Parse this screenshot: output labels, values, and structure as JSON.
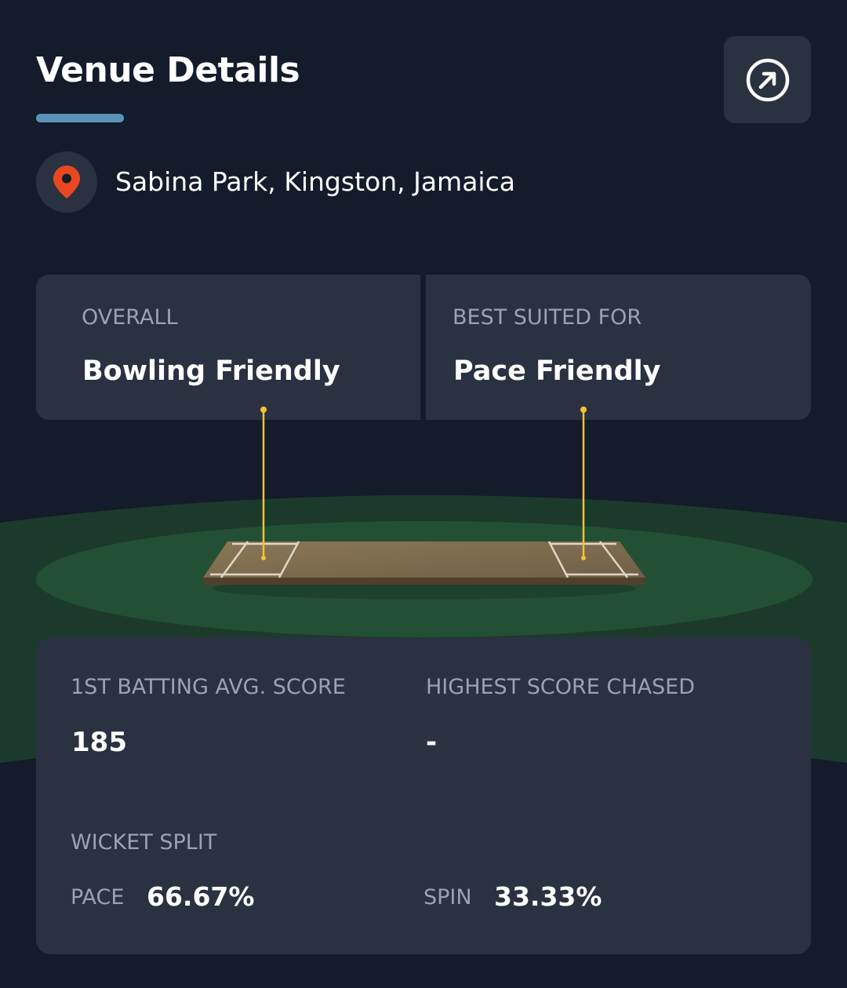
{
  "header": {
    "title": "Venue Details",
    "open_icon": "arrow-up-right-circle-icon"
  },
  "location": {
    "icon": "map-pin-icon",
    "pin_color": "#e8471f",
    "text": "Sabina Park, Kingston, Jamaica"
  },
  "summary": {
    "overall": {
      "label": "OVERALL",
      "value": "Bowling Friendly"
    },
    "best_suited": {
      "label": "BEST SUITED FOR",
      "value": "Pace Friendly"
    }
  },
  "stats": {
    "first_batting_avg": {
      "label": "1ST BATTING AVG. SCORE",
      "value": "185"
    },
    "highest_chased": {
      "label": "HIGHEST SCORE CHASED",
      "value": "-"
    },
    "wicket_split": {
      "label": "WICKET SPLIT",
      "pace_label": "PACE",
      "pace_value": "66.67%",
      "spin_label": "SPIN",
      "spin_value": "33.33%"
    }
  },
  "colors": {
    "background": "#141b2a",
    "card": "#2a3140",
    "accent_underline": "#5b93b8",
    "marker_line": "#f2c233",
    "field_outer": "#1c3a2c",
    "field_inner": "#235034"
  }
}
